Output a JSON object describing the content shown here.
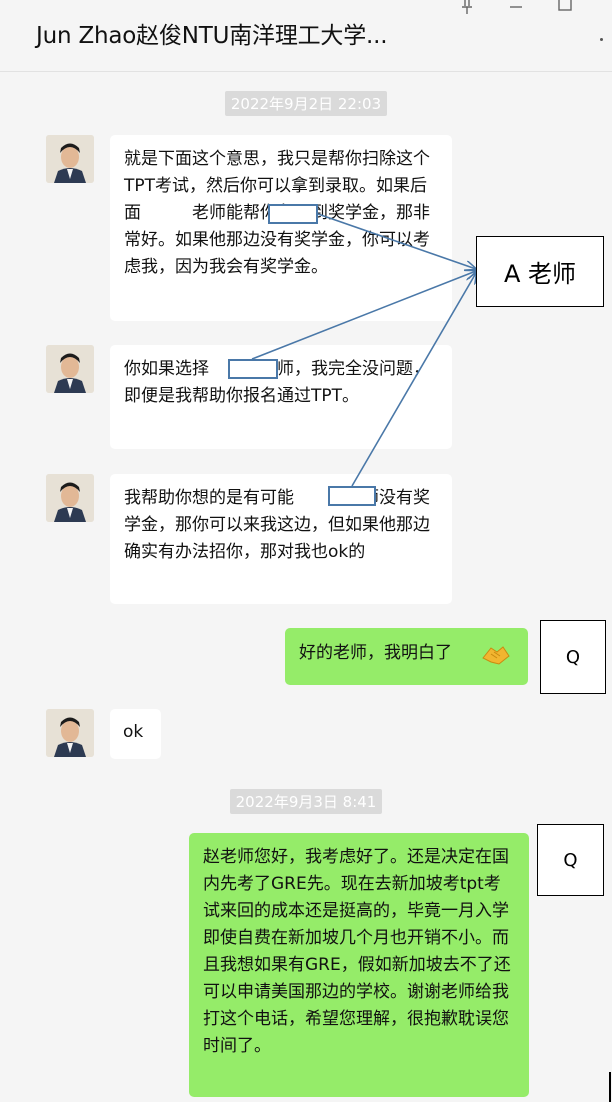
{
  "window": {
    "title": "Jun Zhao赵俊NTU南洋理工大学..."
  },
  "chat": {
    "timestamps": [
      "2022年9月2日 22:03",
      "2022年9月3日 8:41"
    ],
    "messages": [
      {
        "sender": "Jun Zhao",
        "side": "left",
        "text": "就是下面这个意思，我只是帮你扫除这个TPT考试，然后你可以拿到录取。如果后面　　　老师能帮你争取到奖学金，那非常好。如果他那边没有奖学金，你可以考虑我，因为我会有奖学金。"
      },
      {
        "sender": "Jun Zhao",
        "side": "left",
        "text": "你如果选择　　　老师，我完全没问题，即便是我帮助你报名通过TPT。"
      },
      {
        "sender": "Jun Zhao",
        "side": "left",
        "text": "我帮助你想的是有可能　　　老师没有奖学金，那你可以来我这边，但如果他那边确实有办法招你，那对我也ok的"
      },
      {
        "sender": "me",
        "side": "right",
        "text": "好的老师，我明白了"
      },
      {
        "sender": "Jun Zhao",
        "side": "left",
        "text": "ok"
      },
      {
        "sender": "me",
        "side": "right",
        "text": "赵老师您好，我考虑好了。还是决定在国内先考了GRE先。现在去新加坡考tpt考试来回的成本还是挺高的，毕竟一月入学即使自费在新加坡几个月也开销不小。而且我想如果有GRE，假如新加坡去不了还可以申请美国那边的学校。谢谢老师给我打这个电话，希望您理解，很抱歉耽误您时间了。"
      }
    ]
  },
  "annotations": {
    "teacher_label": "A 老师",
    "q_label_1": "Q",
    "q_label_2": "Q"
  },
  "icons": [
    "pin-icon",
    "minimize-icon",
    "maximize-icon",
    "more-icon",
    "avatar-photo",
    "handshake-emoji"
  ],
  "colors": {
    "background": "#f5f5f5",
    "bubble_left": "#ffffff",
    "bubble_right": "#95ec69",
    "redaction_border": "#4a78a8",
    "arrow": "#4a78a8"
  }
}
